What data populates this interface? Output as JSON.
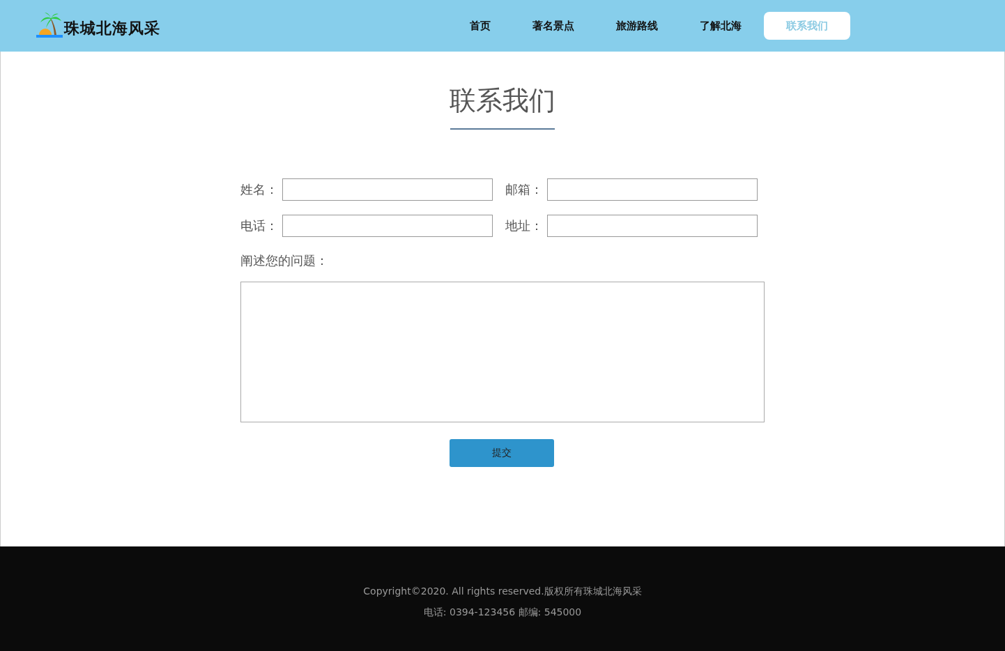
{
  "header": {
    "logo": "珠城北海风采",
    "nav": [
      {
        "label": "首页",
        "selected": false
      },
      {
        "label": "著名景点",
        "selected": false
      },
      {
        "label": "旅游路线",
        "selected": false
      },
      {
        "label": "了解北海",
        "selected": false
      },
      {
        "label": "联系我们",
        "selected": true
      }
    ]
  },
  "title": "联系我们",
  "form": {
    "fields": [
      {
        "label": "姓名："
      },
      {
        "label": "邮箱："
      },
      {
        "label": "电话："
      },
      {
        "label": "地址："
      }
    ],
    "question_label": "阐述您的问题：",
    "submit": "提交"
  },
  "footer": {
    "lines": [
      "Copyright©2020. All rights reserved.版权所有珠城北海风采",
      "电话: 0394-123456 邮编: 545000"
    ]
  }
}
